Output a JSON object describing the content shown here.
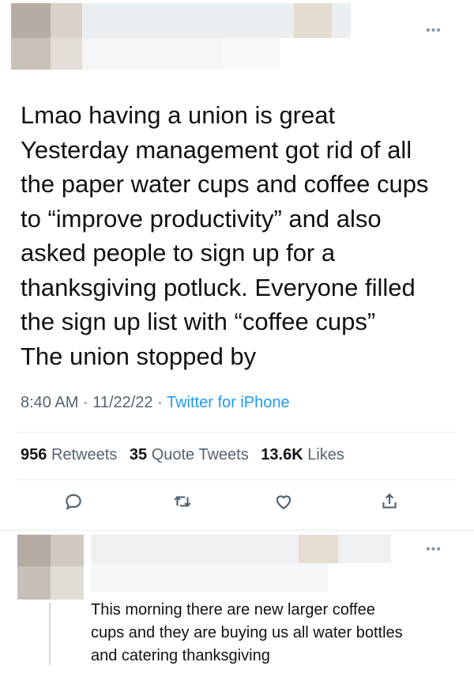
{
  "tweet": {
    "text_lines": [
      "Lmao having a union is great",
      "Yesterday management got rid of all",
      "the paper water cups and coffee cups",
      "to “improve productivity” and also",
      "asked people to sign up for a",
      "thanksgiving potluck. Everyone filled",
      "the sign up list with “coffee cups”",
      "The union stopped by"
    ],
    "time": "8:40 AM",
    "date": "11/22/22",
    "source": "Twitter for iPhone",
    "separator": "·",
    "stats": {
      "retweets_count": "956",
      "retweets_label": "Retweets",
      "quotes_count": "35",
      "quotes_label": "Quote Tweets",
      "likes_count": "13.6K",
      "likes_label": "Likes"
    },
    "more_menu": "•••",
    "actions": [
      "reply-icon",
      "retweet-icon",
      "like-icon",
      "share-icon"
    ]
  },
  "reply": {
    "text_lines": [
      "This morning there are new larger coffee",
      "cups and they are buying us all water bottles",
      "and catering thanksgiving"
    ],
    "more_menu": "•••"
  },
  "colors": {
    "muted": "#536471",
    "link": "#1d9bf0",
    "divider": "#e6ecf0"
  }
}
